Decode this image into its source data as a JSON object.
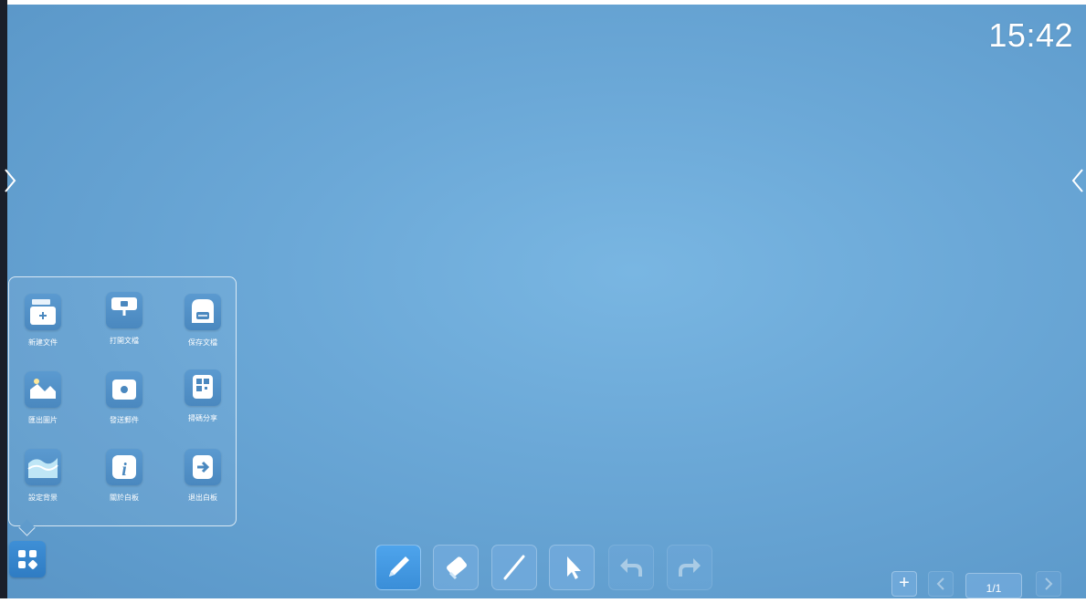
{
  "status": {
    "clock": "15:42"
  },
  "menu": {
    "items": [
      {
        "label": "新建文件",
        "icon": "new-file-icon"
      },
      {
        "label": "打開文檔",
        "icon": "open-document-icon"
      },
      {
        "label": "保存文檔",
        "icon": "save-document-icon"
      },
      {
        "label": "匯出圖片",
        "icon": "export-image-icon"
      },
      {
        "label": "發送郵件",
        "icon": "send-mail-icon"
      },
      {
        "label": "掃碼分享",
        "icon": "qr-share-icon"
      },
      {
        "label": "設定背景",
        "icon": "background-icon"
      },
      {
        "label": "關於白板",
        "icon": "info-icon"
      },
      {
        "label": "退出白板",
        "icon": "exit-icon"
      }
    ]
  },
  "toolbar": {
    "tools": [
      "pen-icon",
      "eraser-icon",
      "line-icon",
      "select-cursor-icon",
      "undo-icon",
      "redo-icon"
    ]
  },
  "pager": {
    "add": "+",
    "indicator": "1/1"
  },
  "colors": {
    "accent": "#3a8ed8",
    "background": "#6ba8d7"
  }
}
